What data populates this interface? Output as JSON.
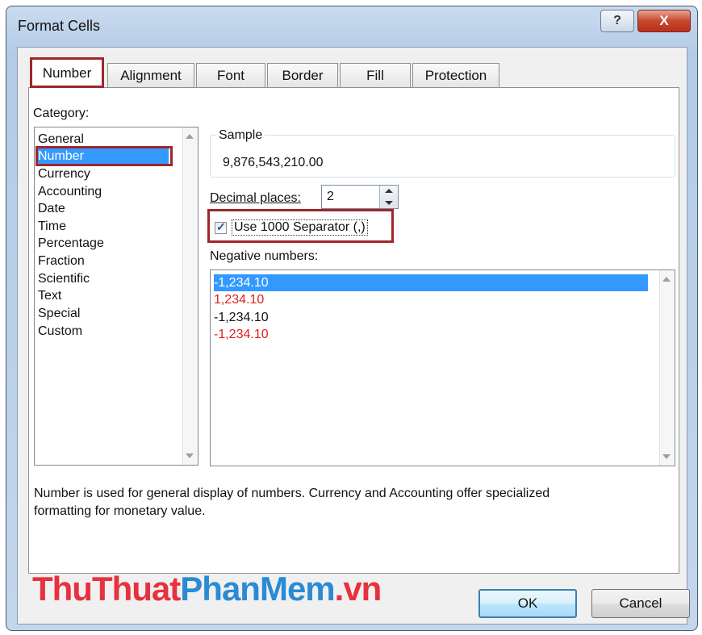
{
  "window": {
    "title": "Format Cells",
    "help_label": "?",
    "close_label": "X"
  },
  "tabs": [
    {
      "label": "Number",
      "active": true
    },
    {
      "label": "Alignment",
      "active": false
    },
    {
      "label": "Font",
      "active": false
    },
    {
      "label": "Border",
      "active": false
    },
    {
      "label": "Fill",
      "active": false
    },
    {
      "label": "Protection",
      "active": false
    }
  ],
  "category": {
    "label": "Category:",
    "items": [
      "General",
      "Number",
      "Currency",
      "Accounting",
      "Date",
      "Time",
      "Percentage",
      "Fraction",
      "Scientific",
      "Text",
      "Special",
      "Custom"
    ],
    "selected": "Number"
  },
  "sample": {
    "label": "Sample",
    "value": "9,876,543,210.00"
  },
  "decimal_places": {
    "label": "Decimal places:",
    "value": "2"
  },
  "separator": {
    "label": "Use 1000 Separator (,)",
    "checked": true
  },
  "negative_numbers": {
    "label": "Negative numbers:",
    "items": [
      {
        "text": "-1,234.10",
        "color": "#000000",
        "selected": true
      },
      {
        "text": "1,234.10",
        "color": "#e02020",
        "selected": false
      },
      {
        "text": "-1,234.10",
        "color": "#000000",
        "selected": false
      },
      {
        "text": "-1,234.10",
        "color": "#e02020",
        "selected": false
      }
    ]
  },
  "description": {
    "line1": "Number is used for general display of numbers.  Currency and Accounting offer specialized",
    "line2": "formatting for monetary value."
  },
  "buttons": {
    "ok": "OK",
    "cancel": "Cancel"
  },
  "watermark": {
    "part1": "ThuThuat",
    "part2": "PhanMem",
    "part3": ".vn"
  },
  "colors": {
    "highlight_box": "#a0262b",
    "selection": "#3399ff"
  }
}
